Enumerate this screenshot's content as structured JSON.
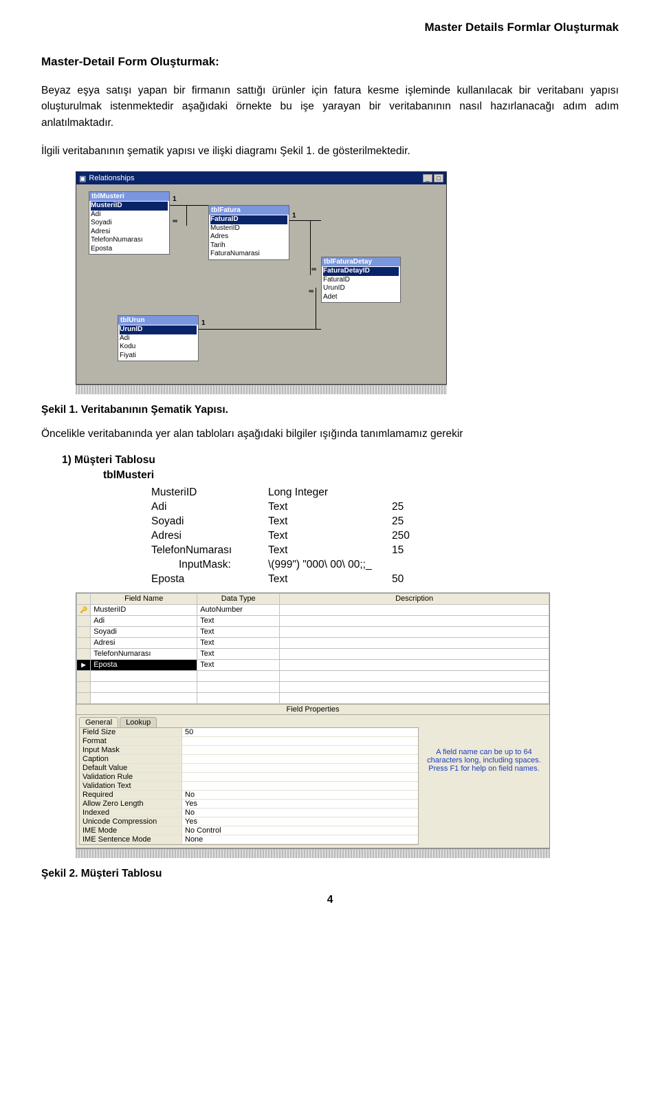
{
  "header": {
    "right": "Master Details Formlar Oluşturmak"
  },
  "h2": "Master-Detail Form Oluşturmak:",
  "para1": "Beyaz eşya satışı yapan bir firmanın sattığı ürünler için fatura kesme işleminde kullanılacak bir veritabanı yapısı oluşturulmak istenmektedir aşağıdaki örnekte bu işe yarayan bir veritabanının nasıl hazırlanacağı adım adım anlatılmaktadır.",
  "para2": "İlgili veritabanının şematik yapısı ve ilişki diagramı Şekil 1. de gösterilmektedir.",
  "rel": {
    "title": "Relationships",
    "tblMusteri": {
      "head": "tblMusteri",
      "pk": "MusteriID",
      "fields": [
        "Adi",
        "Soyadi",
        "Adresi",
        "TelefonNumarası",
        "Eposta"
      ]
    },
    "tblFatura": {
      "head": "tblFatura",
      "pk": "FaturaID",
      "fields": [
        "MusteriID",
        "Adres",
        "Tarih",
        "FaturaNumarasi"
      ]
    },
    "tblFaturaDetay": {
      "head": "tblFaturaDetay",
      "pk": "FaturaDetayID",
      "fields": [
        "FaturaID",
        "UrunID",
        "Adet"
      ]
    },
    "tblUrun": {
      "head": "tblUrun",
      "pk": "UrunID",
      "fields": [
        "Adi",
        "Kodu",
        "Fiyati"
      ]
    }
  },
  "one": "1",
  "inf": "∞",
  "caption1": "Şekil 1. Veritabanının Şematik Yapısı.",
  "para3": "Öncelikle veritabanında yer alan tabloları aşağıdaki bilgiler ışığında tanımlamamız gerekir",
  "list1": "1)  Müşteri Tablosu",
  "tbl1name": "tblMusteri",
  "tbl1": {
    "r1": {
      "n": "MusteriID",
      "t": "Long Integer",
      "s": ""
    },
    "r2": {
      "n": "Adi",
      "t": "Text",
      "s": "25"
    },
    "r3": {
      "n": "Soyadi",
      "t": "Text",
      "s": "25"
    },
    "r4": {
      "n": "Adresi",
      "t": "Text",
      "s": "250"
    },
    "r5": {
      "n": "TelefonNumarası",
      "t": "Text",
      "s": "15"
    },
    "r5b": {
      "n": "InputMask:",
      "t": "\\(999\") \"000\\ 00\\ 00;;_",
      "s": ""
    },
    "r6": {
      "n": "Eposta",
      "t": "Text",
      "s": "50"
    }
  },
  "des": {
    "hdr": {
      "fn": "Field Name",
      "dt": "Data Type",
      "de": "Description"
    },
    "rows": [
      {
        "k": "🔑",
        "n": "MusteriID",
        "t": "AutoNumber"
      },
      {
        "k": "",
        "n": "Adi",
        "t": "Text"
      },
      {
        "k": "",
        "n": "Soyadi",
        "t": "Text"
      },
      {
        "k": "",
        "n": "Adresi",
        "t": "Text"
      },
      {
        "k": "",
        "n": "TelefonNumarası",
        "t": "Text"
      },
      {
        "k": "▶",
        "n": "Eposta",
        "t": "Text",
        "sel": true
      }
    ],
    "fp_title": "Field Properties",
    "tabs": {
      "a": "General",
      "b": "Lookup"
    },
    "props": [
      {
        "k": "Field Size",
        "v": "50"
      },
      {
        "k": "Format",
        "v": ""
      },
      {
        "k": "Input Mask",
        "v": ""
      },
      {
        "k": "Caption",
        "v": ""
      },
      {
        "k": "Default Value",
        "v": ""
      },
      {
        "k": "Validation Rule",
        "v": ""
      },
      {
        "k": "Validation Text",
        "v": ""
      },
      {
        "k": "Required",
        "v": "No"
      },
      {
        "k": "Allow Zero Length",
        "v": "Yes"
      },
      {
        "k": "Indexed",
        "v": "No"
      },
      {
        "k": "Unicode Compression",
        "v": "Yes"
      },
      {
        "k": "IME Mode",
        "v": "No Control"
      },
      {
        "k": "IME Sentence Mode",
        "v": "None"
      }
    ],
    "help": "A field name can be up to 64 characters long, including spaces.  Press F1 for help on field names."
  },
  "caption2": "Şekil 2. Müşteri Tablosu",
  "pagenum": "4"
}
